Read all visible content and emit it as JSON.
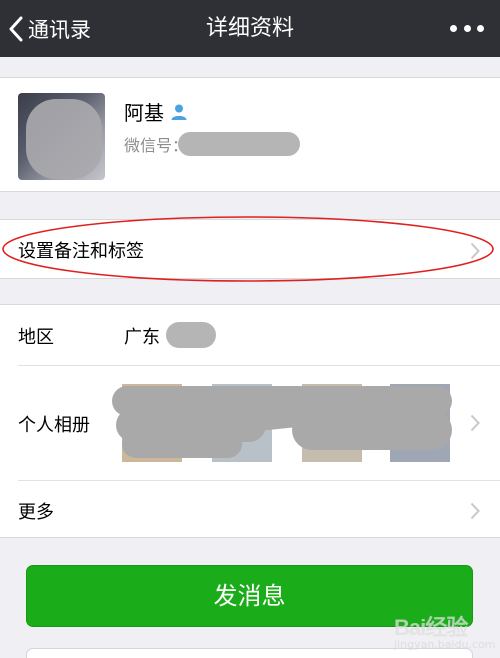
{
  "navbar": {
    "back_label": "通讯录",
    "title": "详细资料",
    "background": "#2f3035"
  },
  "profile": {
    "name": "阿基",
    "wechat_id_label": "微信号："
  },
  "remark": {
    "label": "设置备注和标签",
    "highlight_color": "#e02020"
  },
  "info": {
    "region_label": "地区",
    "region_value": "广东",
    "album_label": "个人相册",
    "more_label": "更多"
  },
  "actions": {
    "send_message_label": "发消息",
    "button_color": "#1aad19"
  },
  "watermark": {
    "text": "Bai经验",
    "subtext": "jingyan.baidu.com"
  }
}
